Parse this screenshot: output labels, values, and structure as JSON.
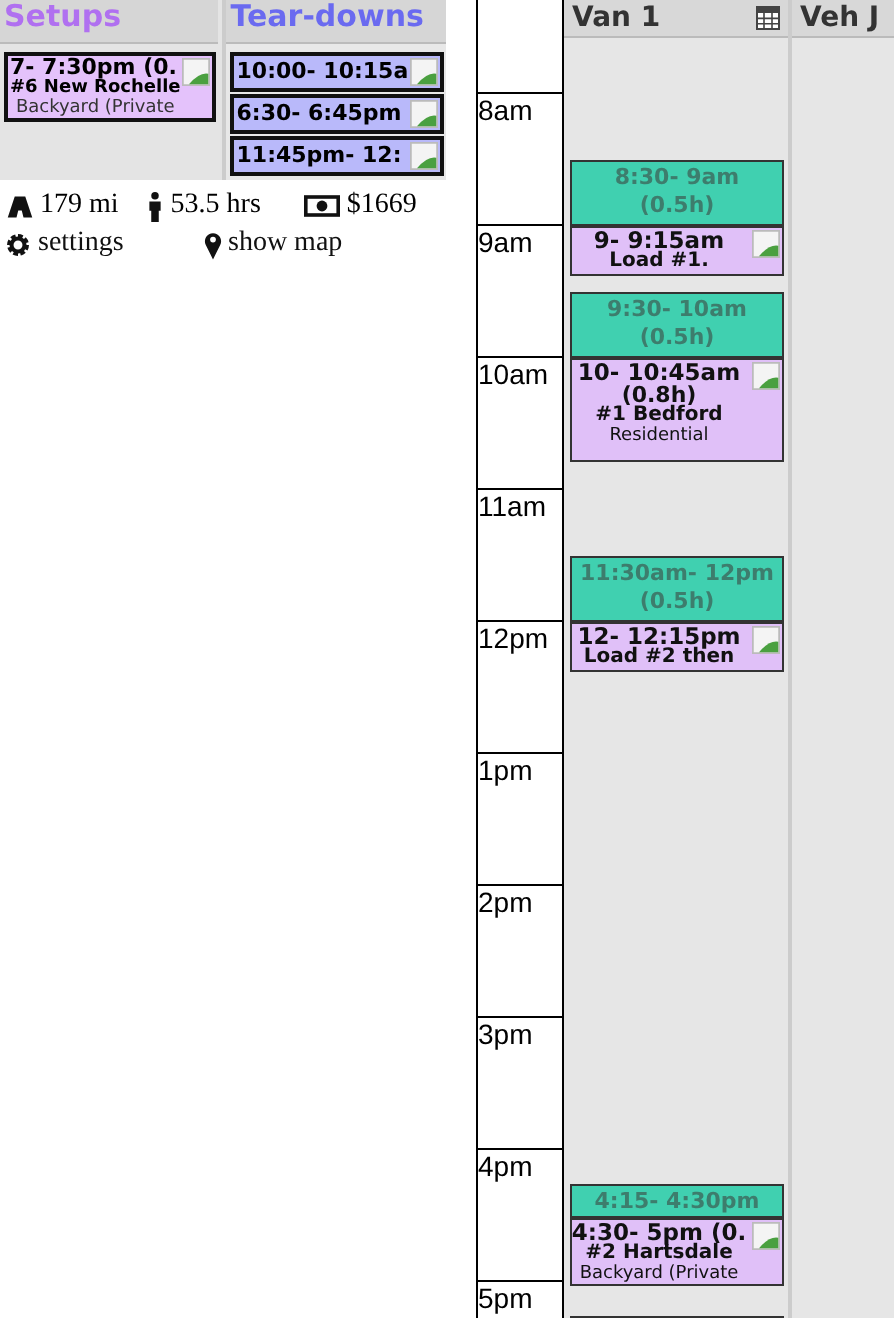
{
  "setups": {
    "title": "Setups",
    "cards": [
      {
        "time": "7- 7:30pm (0.",
        "title": "#6 New Rochelle",
        "subtitle": "Backyard (Private"
      }
    ]
  },
  "teardowns": {
    "title": "Tear-downs",
    "cards": [
      {
        "time": "10:00- 10:15a"
      },
      {
        "time": "6:30- 6:45pm"
      },
      {
        "time": "11:45pm- 12:"
      }
    ]
  },
  "stats": [
    {
      "kind": "road",
      "text": "179 mi"
    },
    {
      "kind": "person",
      "text": "53.5 hrs"
    },
    {
      "kind": "money",
      "text": "$1669"
    }
  ],
  "links": [
    {
      "kind": "settings",
      "text": "settings"
    },
    {
      "kind": "map",
      "text": "show map"
    }
  ],
  "hours": [
    "8am",
    "9am",
    "10am",
    "11am",
    "12pm",
    "1pm",
    "2pm",
    "3pm",
    "4pm",
    "5pm"
  ],
  "columns": [
    {
      "title": "Van 1",
      "calendar_icon": true
    },
    {
      "title": "Veh J"
    }
  ],
  "events": [
    {
      "kind": "travel",
      "time": "8:30- 9am",
      "duration": "(0.5h)"
    },
    {
      "kind": "job",
      "time": "9- 9:15am",
      "title": "Load #1."
    },
    {
      "kind": "travel",
      "time": "9:30- 10am",
      "duration": "(0.5h)"
    },
    {
      "kind": "job",
      "time": "10- 10:45am",
      "duration": "(0.8h)",
      "title": "#1 Bedford",
      "subtitle": "Residential"
    },
    {
      "kind": "travel",
      "time": "11:30am- 12pm",
      "duration": "(0.5h)"
    },
    {
      "kind": "job",
      "time": "12- 12:15pm",
      "title": "Load #2 then"
    },
    {
      "kind": "travel",
      "time": "4:15- 4:30pm"
    },
    {
      "kind": "job",
      "time": "4:30- 5pm (0.",
      "title": "#2 Hartsdale",
      "subtitle": "Backyard (Private"
    },
    {
      "kind": "travel"
    }
  ]
}
